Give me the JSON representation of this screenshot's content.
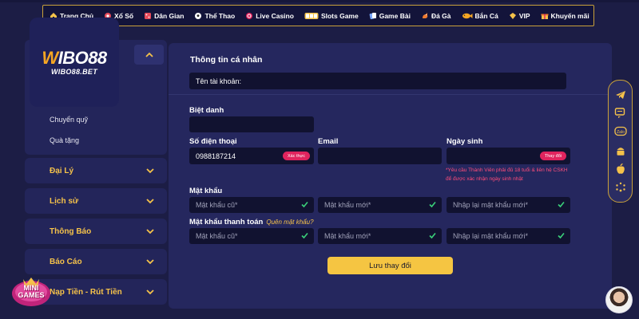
{
  "nav": {
    "items": [
      {
        "label": "Trang Chủ",
        "icon": "home-icon"
      },
      {
        "label": "Xổ Số",
        "icon": "lottery-icon"
      },
      {
        "label": "Dân Gian",
        "icon": "dice-icon"
      },
      {
        "label": "Thể Thao",
        "icon": "soccer-ball-icon"
      },
      {
        "label": "Live Casino",
        "icon": "casino-chip-icon"
      },
      {
        "label": "Slots Game",
        "icon": "slot-machine-icon"
      },
      {
        "label": "Game Bài",
        "icon": "card-game-icon"
      },
      {
        "label": "Đá Gà",
        "icon": "rooster-icon"
      },
      {
        "label": "Bắn Cá",
        "icon": "fish-icon"
      },
      {
        "label": "VIP",
        "icon": "vip-diamond-icon"
      },
      {
        "label": "Khuyến mãi",
        "icon": "gift-icon"
      }
    ]
  },
  "logo": {
    "main": "WIBO88",
    "sub": "WIBO88.BET"
  },
  "sidebar": {
    "open_items": [
      "Chuyển quỹ",
      "Quà tặng"
    ],
    "groups": [
      "Đại Lý",
      "Lịch sử",
      "Thông Báo",
      "Báo Cáo",
      "Nạp Tiền - Rút Tiền"
    ]
  },
  "profile": {
    "section_title": "Thông tin cá nhân",
    "username_label": "Tên tài khoản:",
    "nickname_label": "Biệt danh",
    "nickname_value": "",
    "phone_label": "Số điện thoại",
    "phone_value": "0988187214",
    "phone_verify_btn": "Xác thực",
    "email_label": "Email",
    "email_value": "",
    "dob_label": "Ngày sinh",
    "dob_change_btn": "Thay đổi",
    "dob_note": "*Yêu cầu Thành Viên phải đủ 18 tuổi & liên hệ CSKH để được xác nhận ngày sinh nhật",
    "password_label": "Mật khẩu",
    "pay_password_label": "Mật khẩu thanh toán",
    "forgot_password": "Quên mật khẩu?",
    "ph_old_password": "Mật khẩu cũ*",
    "ph_new_password": "Mật khẩu mới*",
    "ph_confirm_password": "Nhập lại mật khẩu mới*",
    "save_label": "Lưu thay đổi"
  },
  "badges": {
    "mini_games": "MINI GAMES"
  },
  "colors": {
    "accent_gold": "#f5c542",
    "danger_pink": "#e0245e",
    "panel": "#25275e",
    "background": "#1c1d45"
  }
}
